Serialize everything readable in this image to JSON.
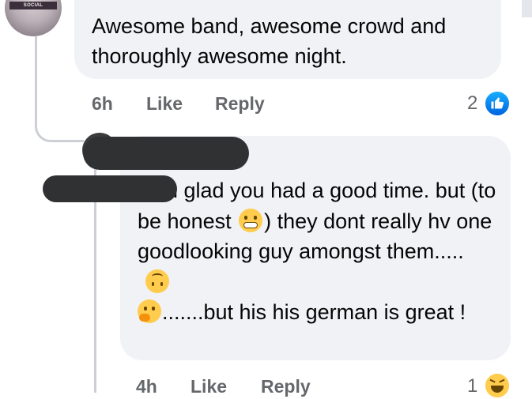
{
  "comment1": {
    "avatar_banner": "SOCIAL",
    "text": "Awesome band, awesome crowd and thoroughly awesome night.",
    "time": "6h",
    "like_label": "Like",
    "reply_label": "Reply",
    "reaction_count": "2",
    "reaction_icon": "like-icon"
  },
  "comment2": {
    "author": "",
    "mention": "",
    "text_part1": ", i m glad you had a good time. but (to be honest ",
    "text_part2": ") they dont really hv one goodlooking guy amongst them..... ",
    "text_part3": ".......but his his german is great !",
    "time": "4h",
    "like_label": "Like",
    "reply_label": "Reply",
    "reaction_count": "1",
    "reaction_icon": "haha-icon",
    "emojis": [
      "grimacing-face",
      "upside-down-face",
      "thinking-face"
    ]
  },
  "colors": {
    "bubble": "#f0f2f5",
    "meta_text": "#65676b",
    "like_blue": "#1877f2",
    "redaction": "#2f3133"
  }
}
